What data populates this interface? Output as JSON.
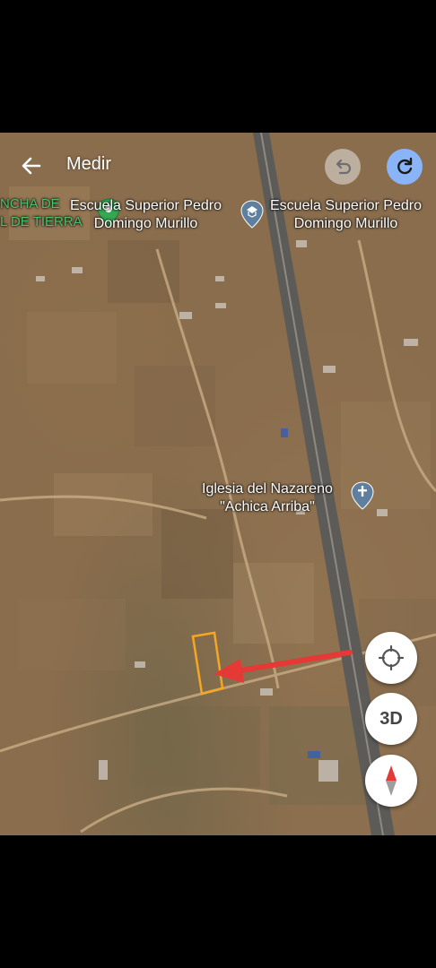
{
  "header": {
    "title": "Medir",
    "back_icon": "arrow-back-icon",
    "undo_icon": "undo-icon",
    "redo_icon": "refresh-icon"
  },
  "map": {
    "places": [
      {
        "line1": "Escuela Superior Pedro",
        "line2": "Domingo Murillo"
      },
      {
        "line1": "Escuela Superior Pedro",
        "line2": "Domingo Murillo"
      },
      {
        "line1": "Iglesia del Nazareno",
        "line2": "\"Achica Arriba\""
      }
    ],
    "partial_label": {
      "line1": "NCHA DE",
      "line2": "L DE TIERRA"
    },
    "measure_color": "#f5a623",
    "arrow_color": "#e53935"
  },
  "controls": {
    "three_d_label": "3D",
    "locate_icon": "my-location-icon",
    "compass_icon": "compass-icon"
  }
}
